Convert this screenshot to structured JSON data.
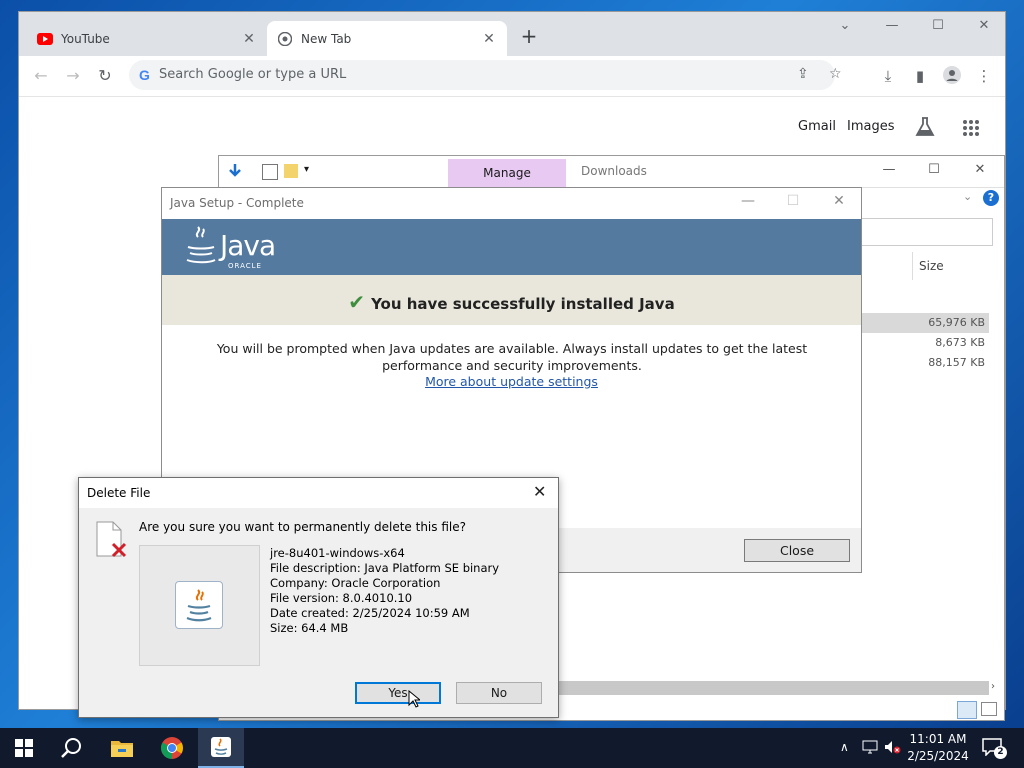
{
  "browser": {
    "tabs": [
      {
        "title": "YouTube",
        "active": false
      },
      {
        "title": "New Tab",
        "active": true
      }
    ],
    "new_tab_symbol": "+",
    "omnibox_placeholder": "Search Google or type a URL",
    "omnibox_g": "G",
    "ntp_links": {
      "gmail": "Gmail",
      "images": "Images"
    },
    "window_controls": {
      "tab_search": "⌄",
      "minimize": "—",
      "maximize": "☐",
      "close": "✕"
    }
  },
  "explorer": {
    "manage_tab": "Manage",
    "title": "Downloads",
    "column_size": "Size",
    "rows": [
      {
        "size": "65,976 KB",
        "selected": true
      },
      {
        "size": "8,673 KB",
        "selected": false
      },
      {
        "size": "88,157 KB",
        "selected": false
      }
    ],
    "help": "?"
  },
  "java_setup": {
    "title": "Java Setup - Complete",
    "logo_text": "Java",
    "logo_sub": "ORACLE",
    "success_message": "You have successfully installed Java",
    "body_message": "You will be prompted when Java updates are available. Always install updates to get the latest performance and security improvements.",
    "link": "More about update settings",
    "close_button": "Close"
  },
  "delete_dialog": {
    "title": "Delete File",
    "question": "Are you sure you want to permanently delete this file?",
    "file_name": "jre-8u401-windows-x64",
    "file_description": "File description: Java Platform SE binary",
    "company": "Company: Oracle Corporation",
    "file_version": "File version: 8.0.4010.10",
    "date_created": "Date created: 2/25/2024 10:59 AM",
    "size": "Size: 64.4 MB",
    "yes_button": "Yes",
    "no_button": "No"
  },
  "taskbar": {
    "time": "11:01 AM",
    "date": "2/25/2024",
    "notification_count": "2",
    "items": [
      "start-icon",
      "search-icon",
      "file-explorer-icon",
      "chrome-icon",
      "java-setup-icon"
    ]
  },
  "colors": {
    "java_banner": "#557aa0",
    "success_band": "#e9e7db",
    "manage_tab": "#e8c9f2",
    "taskbar": "#101a2c",
    "link": "#2257a8"
  }
}
